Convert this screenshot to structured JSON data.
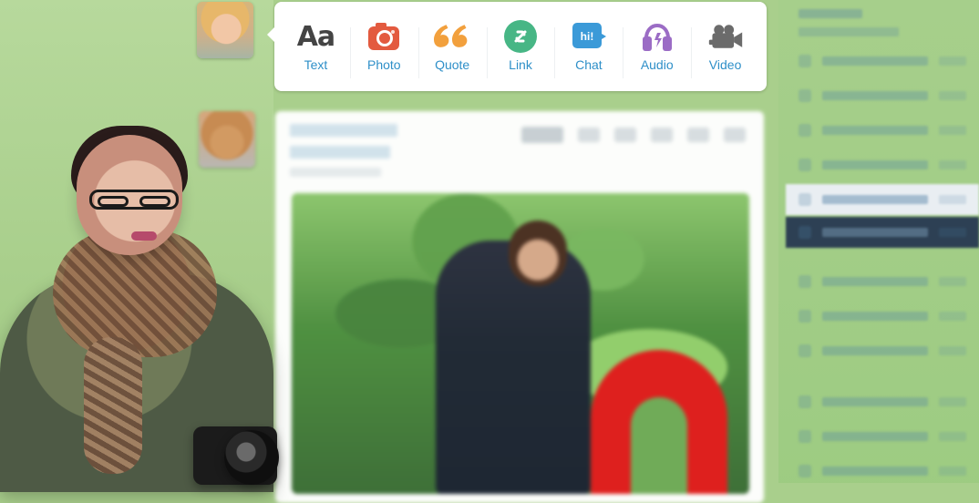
{
  "post_types": [
    {
      "key": "text",
      "label": "Text",
      "icon": "text-icon",
      "color": "#444444"
    },
    {
      "key": "photo",
      "label": "Photo",
      "icon": "camera-icon",
      "color": "#e35a3f"
    },
    {
      "key": "quote",
      "label": "Quote",
      "icon": "quote-icon",
      "color": "#f2a03d"
    },
    {
      "key": "link",
      "label": "Link",
      "icon": "link-icon",
      "color": "#47b685"
    },
    {
      "key": "chat",
      "label": "Chat",
      "icon": "chat-bubble-icon",
      "color": "#3b9ad8"
    },
    {
      "key": "audio",
      "label": "Audio",
      "icon": "headphones-icon",
      "color": "#9b6cc5"
    },
    {
      "key": "video",
      "label": "Video",
      "icon": "video-camera-icon",
      "color": "#6b6b6b"
    }
  ],
  "chat_icon_text": "hi!",
  "text_icon_text": "Aa",
  "colors": {
    "background": "#a9cf8c",
    "label_blue": "#2e8fc8",
    "card": "#ffffff",
    "sidebar_selected": "#e9eef2",
    "sidebar_dark": "#2d4054"
  }
}
